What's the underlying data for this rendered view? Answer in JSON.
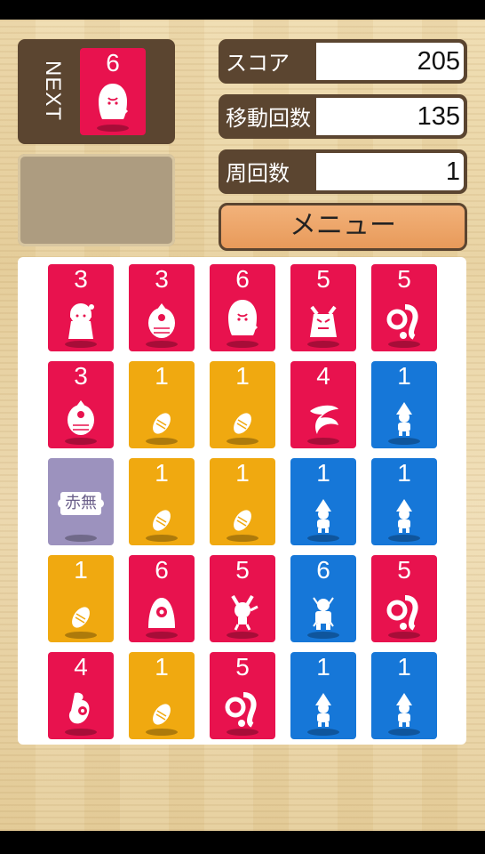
{
  "next": {
    "label": "NEXT",
    "card": {
      "value": "6",
      "color": "red",
      "icon": "long-hair-ghost-icon"
    }
  },
  "stats": [
    {
      "label": "スコア",
      "value": "205"
    },
    {
      "label": "移動回数",
      "value": "135"
    },
    {
      "label": "周回数",
      "value": "1"
    }
  ],
  "menu_label": "メニュー",
  "colors": {
    "red": "#e8124e",
    "yellow": "#f0a910",
    "blue": "#1677d8",
    "scroll": "#9c92be",
    "panel": "#5b4530"
  },
  "board": [
    [
      {
        "value": "3",
        "color": "red",
        "icon": "girl-yokai-icon"
      },
      {
        "value": "3",
        "color": "red",
        "icon": "fish-yokai-icon"
      },
      {
        "value": "6",
        "color": "red",
        "icon": "long-hair-ghost-icon"
      },
      {
        "value": "5",
        "color": "red",
        "icon": "oni-icon"
      },
      {
        "value": "5",
        "color": "red",
        "icon": "tentacle-yokai-icon"
      }
    ],
    [
      {
        "value": "3",
        "color": "red",
        "icon": "fish-yokai-icon"
      },
      {
        "value": "1",
        "color": "yellow",
        "icon": "coin-icon"
      },
      {
        "value": "1",
        "color": "yellow",
        "icon": "coin-icon"
      },
      {
        "value": "4",
        "color": "red",
        "icon": "dragon-icon"
      },
      {
        "value": "1",
        "color": "blue",
        "icon": "hooded-villager-icon"
      }
    ],
    [
      {
        "value": "",
        "color": "scroll",
        "icon": "scroll-icon",
        "scroll_text": "赤無"
      },
      {
        "value": "1",
        "color": "yellow",
        "icon": "coin-icon"
      },
      {
        "value": "1",
        "color": "yellow",
        "icon": "coin-icon"
      },
      {
        "value": "1",
        "color": "blue",
        "icon": "hooded-villager-icon"
      },
      {
        "value": "1",
        "color": "blue",
        "icon": "hooded-villager-icon"
      }
    ],
    [
      {
        "value": "1",
        "color": "yellow",
        "icon": "coin-icon"
      },
      {
        "value": "6",
        "color": "red",
        "icon": "one-eyed-monster-icon"
      },
      {
        "value": "5",
        "color": "red",
        "icon": "imp-icon"
      },
      {
        "value": "6",
        "color": "blue",
        "icon": "samurai-icon"
      },
      {
        "value": "5",
        "color": "red",
        "icon": "tentacle-yokai-icon"
      }
    ],
    [
      {
        "value": "4",
        "color": "red",
        "icon": "spiral-yokai-icon"
      },
      {
        "value": "1",
        "color": "yellow",
        "icon": "coin-icon"
      },
      {
        "value": "5",
        "color": "red",
        "icon": "tentacle-yokai-icon"
      },
      {
        "value": "1",
        "color": "blue",
        "icon": "hooded-villager-icon"
      },
      {
        "value": "1",
        "color": "blue",
        "icon": "hooded-villager-icon"
      }
    ]
  ]
}
